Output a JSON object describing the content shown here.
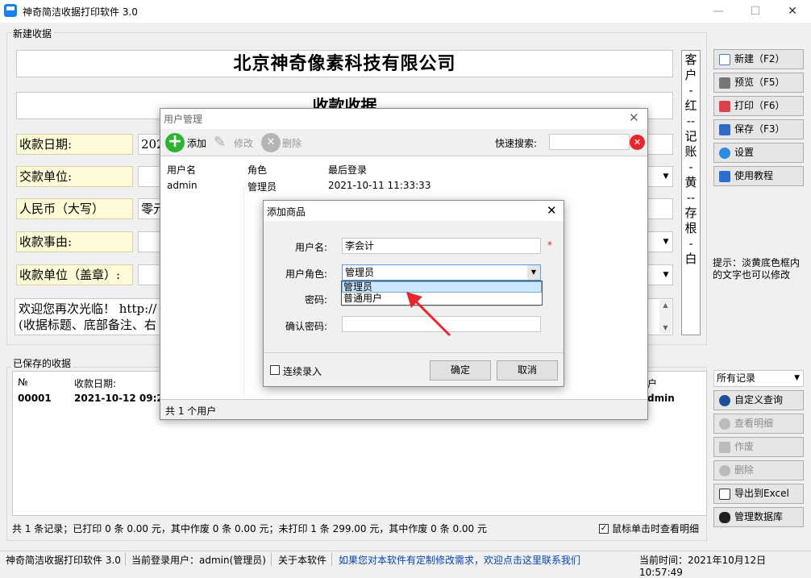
{
  "window": {
    "title": "神奇简洁收据打印软件 3.0",
    "min": "—",
    "max": "☐",
    "close": "✕"
  },
  "new_receipt": {
    "group_label": "新建收据",
    "company": "北京神奇像素科技有限公司",
    "doc_title": "收款收据",
    "labels": {
      "date": "收款日期:",
      "payer": "交款单位:",
      "rmb": "人民币（大写）",
      "reason": "收款事由:",
      "payee": "收款单位（盖章）:"
    },
    "values": {
      "date": "202",
      "rmb": "零元"
    },
    "memo_line1": "欢迎您再次光临！ http://",
    "memo_line2": "(收据标题、底部备注、右"
  },
  "copies_label": [
    "客",
    "户",
    "-",
    "红",
    "--",
    "记",
    "账",
    "-",
    "黄",
    "--",
    "存",
    "根",
    "-",
    "白"
  ],
  "right_buttons": {
    "new": "新建（F2）",
    "preview": "预览（F5）",
    "print": "打印（F6）",
    "save": "保存（F3）",
    "settings": "设置",
    "tutorial": "使用教程"
  },
  "tip": "提示：淡黄底色框内的文字也可以修改",
  "saved": {
    "group_label": "已保存的收据",
    "columns": {
      "no": "№",
      "date": "收款日期:",
      "user": "户"
    },
    "row": {
      "no": "00001",
      "date": "2021-10-12 09:2",
      "user": "dmin"
    },
    "filter": "所有记录",
    "buttons": {
      "custom_query": "自定义查询",
      "view_detail": "查看明细",
      "void": "作废",
      "delete": "删除",
      "export": "导出到Excel",
      "manage_db": "管理数据库"
    },
    "summary": "共 1 条记录；已打印 0 条 0.00 元，其中作废 0 条 0.00 元；未打印 1 条 299.00 元，其中作废 0 条 0.00 元",
    "click_detail": "鼠标单击时查看明细",
    "click_detail_checked": "✓"
  },
  "statusbar": {
    "app": "神奇简洁收据打印软件 3.0",
    "user": "当前登录用户：admin(管理员)",
    "about": "关于本软件",
    "custom_link": "如果您对本软件有定制修改需求，欢迎点击这里联系我们",
    "time": "当前时间：2021年10月12日 10:57:49"
  },
  "user_mgmt": {
    "title": "用户管理",
    "close": "✕",
    "add": "添加",
    "edit": "修改",
    "delete": "删除",
    "search_label": "快速搜索:",
    "search_value": "",
    "columns": [
      "用户名",
      "角色",
      "最后登录"
    ],
    "rows": [
      {
        "name": "admin",
        "role": "管理员",
        "last_login": "2021-10-11 11:33:33"
      }
    ],
    "footer": "共 1 个用户"
  },
  "add_dialog": {
    "title": "添加商品",
    "close": "✕",
    "username_label": "用户名:",
    "username_value": "李会计",
    "required": "*",
    "role_label": "用户角色:",
    "role_value": "管理员",
    "role_options": [
      "管理员",
      "普通用户"
    ],
    "password_label": "密码:",
    "confirm_label": "确认密码:",
    "continuous_label": "连续录入",
    "ok": "确定",
    "cancel": "取消"
  },
  "colors": {
    "accent_red": "#e8262e",
    "highlight": "#cce8ff",
    "label_bg": "#fdfbd7"
  }
}
